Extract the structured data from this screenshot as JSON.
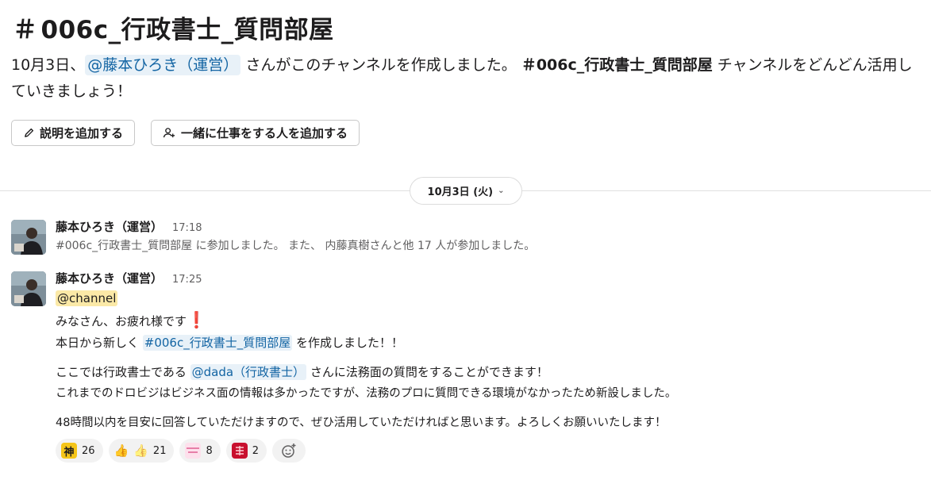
{
  "channel": {
    "hash": "＃",
    "name": "006c_行政書士_質問部屋"
  },
  "intro": {
    "part1": "10月3日、",
    "mention": "@藤本ひろき（運営）",
    "part2": " さんがこのチャンネルを作成しました。",
    "channel_bold": "＃006c_行政書士_質問部屋",
    "part3": " チャンネルをどんどん活用していきましょう！"
  },
  "buttons": {
    "add_description": "説明を追加する",
    "add_people": "一緒に仕事をする人を追加する"
  },
  "date_divider": {
    "label": "10月3日 (火)"
  },
  "messages": [
    {
      "sender": "藤本ひろき（運営）",
      "time": "17:18",
      "system_text": "#006c_行政書士_質問部屋 に参加しました。 また、 内藤真樹さんと他 17 人が参加しました。"
    },
    {
      "sender": "藤本ひろき（運営）",
      "time": "17:25",
      "channel_mention": "@channel",
      "line1": "みなさん、お疲れ様です",
      "line2_pre": "本日から新しく ",
      "line2_link": "#006c_行政書士_質問部屋",
      "line2_post": " を作成しました！！",
      "line3_pre": "ここでは行政書士である ",
      "line3_mention": "@dada（行政書士）",
      "line3_post": " さんに法務面の質問をすることができます！",
      "line4": "これまでのドロビジはビジネス面の情報は多かったですが、法務のプロに質問できる環境がなかったため新設しました。",
      "line5": "48時間以内を目安に回答していただけますので、ぜひ活用していただければと思います。よろしくお願いいたします！"
    }
  ],
  "reactions": [
    {
      "emoji": "kami-emoji",
      "glyph": "神",
      "count": "26"
    },
    {
      "emoji": "thumbs-up-emoji",
      "glyph": "👍",
      "count": "21"
    },
    {
      "emoji": "sticker-emoji",
      "glyph": "",
      "count": "8"
    },
    {
      "emoji": "red-stamp-emoji",
      "glyph": "",
      "count": "2"
    }
  ],
  "colors": {
    "link": "#1264a3",
    "mention_bg": "#e8f1f8",
    "channel_mention_bg": "#fbe9a7",
    "alert": "#e01e1e"
  }
}
